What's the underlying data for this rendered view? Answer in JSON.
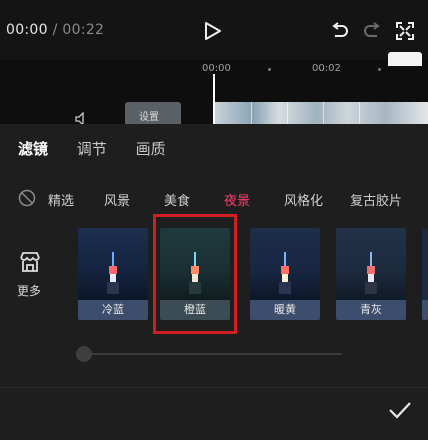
{
  "player": {
    "current_time": "00:00",
    "separator": "/",
    "duration": "00:22"
  },
  "timeline": {
    "ticks": [
      "00:00",
      "00:02"
    ],
    "cover_button": "设置"
  },
  "tabs": [
    {
      "label": "滤镜",
      "active": true
    },
    {
      "label": "调节",
      "active": false
    },
    {
      "label": "画质",
      "active": false
    }
  ],
  "categories": [
    {
      "label": "精选",
      "active": false
    },
    {
      "label": "风景",
      "active": false
    },
    {
      "label": "美食",
      "active": false
    },
    {
      "label": "夜景",
      "active": true
    },
    {
      "label": "风格化",
      "active": false
    },
    {
      "label": "复古胶片",
      "active": false
    }
  ],
  "store": {
    "label": "更多"
  },
  "filters": [
    {
      "label": "冷蓝",
      "selected": false
    },
    {
      "label": "橙蓝",
      "selected": true
    },
    {
      "label": "暖黄",
      "selected": false
    },
    {
      "label": "青灰",
      "selected": false
    }
  ],
  "intensity": {
    "value": 0
  },
  "colors": {
    "accent": "#ff3d6e",
    "selection_border": "#d01f23",
    "label_bg": "#3c4d6d"
  },
  "icons": [
    "play-icon",
    "undo-icon",
    "redo-icon",
    "fullscreen-icon",
    "audio-icon",
    "none-icon",
    "store-icon",
    "checkmark-icon"
  ]
}
